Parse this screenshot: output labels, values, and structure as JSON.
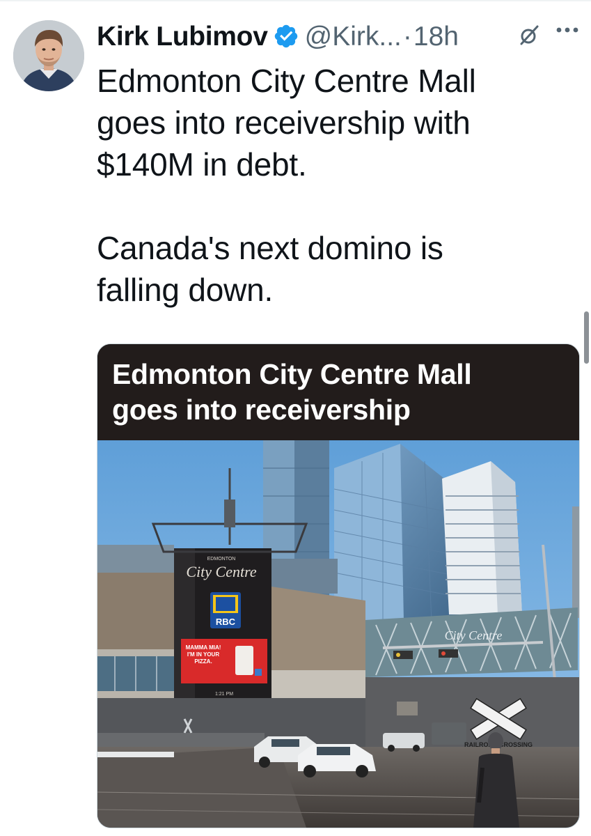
{
  "author": {
    "name": "Kirk Lubimov",
    "handle": "@Kirk...",
    "separator": "·",
    "time": "18h"
  },
  "tweet": {
    "paragraphs": [
      [
        "Edmonton City Centre Mall",
        "goes into receivership with",
        "$140M in debt."
      ],
      [
        "Canada's next domino is",
        "falling down."
      ]
    ]
  },
  "media": {
    "headline_lines": [
      "Edmonton City Centre Mall",
      "goes into receivership"
    ],
    "photo_signs": {
      "sign_top": "EDMONTON",
      "sign_brand": "City Centre",
      "bank": "RBC",
      "billboard": [
        "MAMMA MIA!",
        "I'M IN YOUR",
        "PIZZA."
      ],
      "screen_footer": "1:21 PM",
      "bridge_brand": "City Centre",
      "crossing": "RAILROAD CROSSING"
    }
  },
  "colors": {
    "text": "#0f1419",
    "secondary": "#536471",
    "verified": "#1d9bf0",
    "banner_bg": "#221c1b"
  },
  "icons": {
    "verified": "verified-badge-icon",
    "grok": "grok-icon",
    "more": "more-icon"
  }
}
